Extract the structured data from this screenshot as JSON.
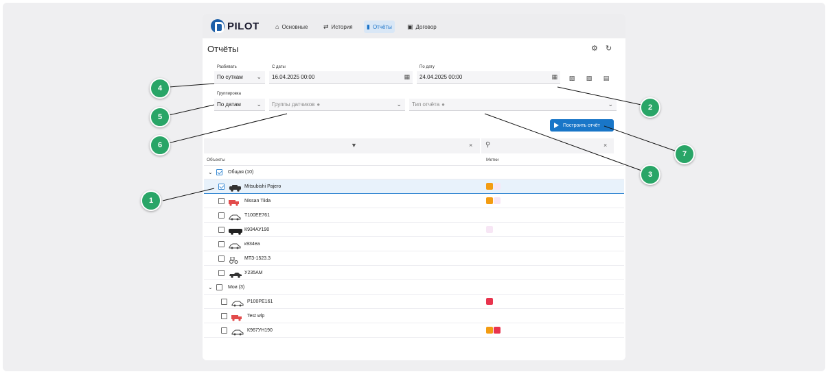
{
  "nav": {
    "logo": "PILOT",
    "items": [
      {
        "label": "Основные",
        "icon": "home-icon"
      },
      {
        "label": "История",
        "icon": "history-icon"
      },
      {
        "label": "Отчёты",
        "icon": "report-icon"
      },
      {
        "label": "Договор",
        "icon": "contract-icon"
      }
    ],
    "active": "Отчёты"
  },
  "page": {
    "title": "Отчёты"
  },
  "filters": {
    "split_label": "Разбивать",
    "split_value": "По суткам",
    "from_label": "С даты",
    "from_value": "16.04.2025 00:00",
    "to_label": "По дату",
    "to_value": "24.04.2025 00:00",
    "group_label": "Группировка",
    "group_value": "По датам",
    "sensor_groups_placeholder": "Группы датчиков",
    "report_type_placeholder": "Тип отчёта"
  },
  "build_button": "Построить отчёт",
  "columns": {
    "objects": "Объекты",
    "tags": "Метки"
  },
  "groups": [
    {
      "name": "Общая (10)",
      "checked": true,
      "items": [
        {
          "name": "Mitsubishi Pajero",
          "checked": true,
          "selected": true,
          "vehicle": "suv-icon",
          "tags": [
            "#f39c12",
            "#f7e6f5"
          ]
        },
        {
          "name": "Nissan Tiida",
          "checked": false,
          "vehicle": "truck-icon",
          "tags": [
            "#f39c12",
            "#f7e6f5"
          ]
        },
        {
          "name": "Т100ЕЕ761",
          "checked": false,
          "vehicle": "car-icon",
          "tags": []
        },
        {
          "name": "К934АУ190",
          "checked": false,
          "vehicle": "van-icon",
          "tags": [
            "#f7e6f5"
          ]
        },
        {
          "name": "к934еа",
          "checked": false,
          "vehicle": "car-icon",
          "tags": []
        },
        {
          "name": "МТЗ-1523.3",
          "checked": false,
          "vehicle": "tractor-icon",
          "tags": []
        },
        {
          "name": "У235АМ",
          "checked": false,
          "vehicle": "pickup-icon",
          "tags": []
        }
      ]
    },
    {
      "name": "Мои (3)",
      "checked": false,
      "items": [
        {
          "name": "Р100РЕ161",
          "checked": false,
          "vehicle": "car-icon",
          "tags": [
            "#e8344e"
          ]
        },
        {
          "name": "Test wlp",
          "checked": false,
          "vehicle": "truck-icon",
          "tags": []
        },
        {
          "name": "К967УН190",
          "checked": false,
          "vehicle": "car-icon",
          "tags": [
            "#f39c12",
            "#e8344e"
          ]
        }
      ]
    }
  ],
  "callouts": [
    "1",
    "2",
    "3",
    "4",
    "5",
    "6",
    "7"
  ]
}
